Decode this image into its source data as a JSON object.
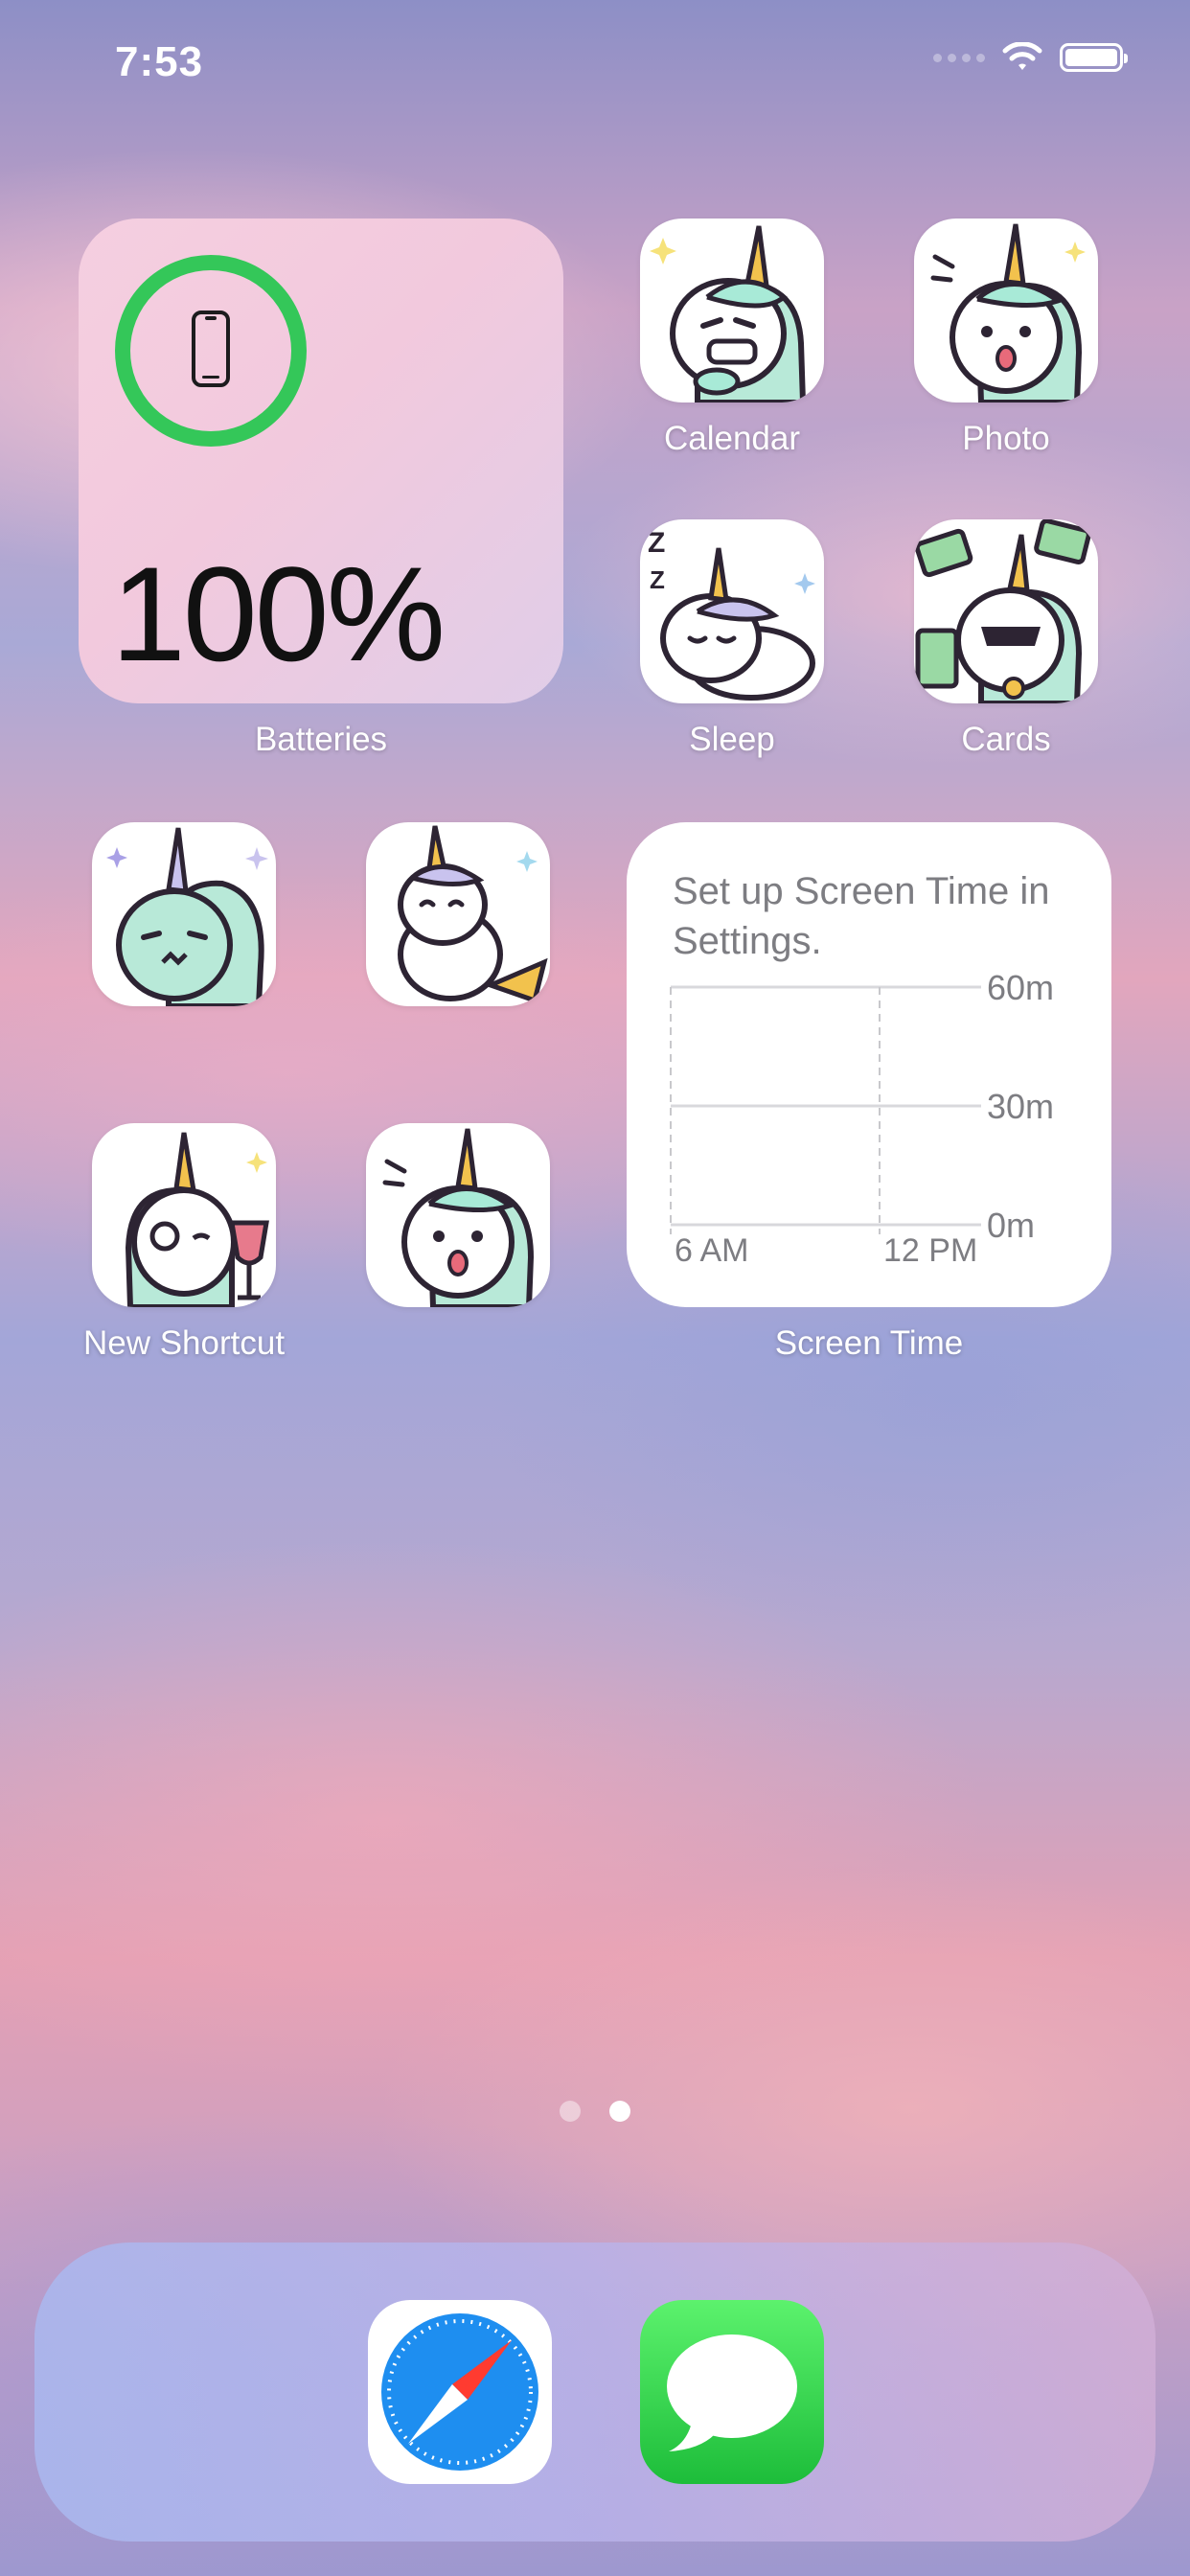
{
  "status_bar": {
    "time": "7:53"
  },
  "battery_widget": {
    "percent": "100%",
    "label": "Batteries",
    "charge_fraction": 1.0,
    "ring_color": "#34c759"
  },
  "apps": [
    {
      "id": "calendar",
      "label": "Calendar"
    },
    {
      "id": "photo",
      "label": "Photo"
    },
    {
      "id": "sleep",
      "label": "Sleep"
    },
    {
      "id": "cards",
      "label": "Cards"
    },
    {
      "id": "unnamed-1",
      "label": ""
    },
    {
      "id": "unnamed-2",
      "label": ""
    },
    {
      "id": "new-shortcut",
      "label": "New Shortcut"
    },
    {
      "id": "unnamed-3",
      "label": ""
    }
  ],
  "screen_time": {
    "label": "Screen Time",
    "message": "Set up Screen Time in Settings.",
    "y_ticks": [
      "60m",
      "30m",
      "0m"
    ],
    "x_ticks": [
      "6 AM",
      "12 PM"
    ]
  },
  "page_indicator": {
    "pages": 2,
    "current": 2
  },
  "dock": [
    {
      "id": "safari",
      "icon": "safari-icon"
    },
    {
      "id": "messages",
      "icon": "messages-icon"
    }
  ],
  "colors": {
    "ring": "#34c759",
    "safari": "#1a8cf0",
    "messages": "#34c759",
    "mane": "#a8ead7",
    "horn": "#f2c24d",
    "body_outline": "#2d2433"
  }
}
